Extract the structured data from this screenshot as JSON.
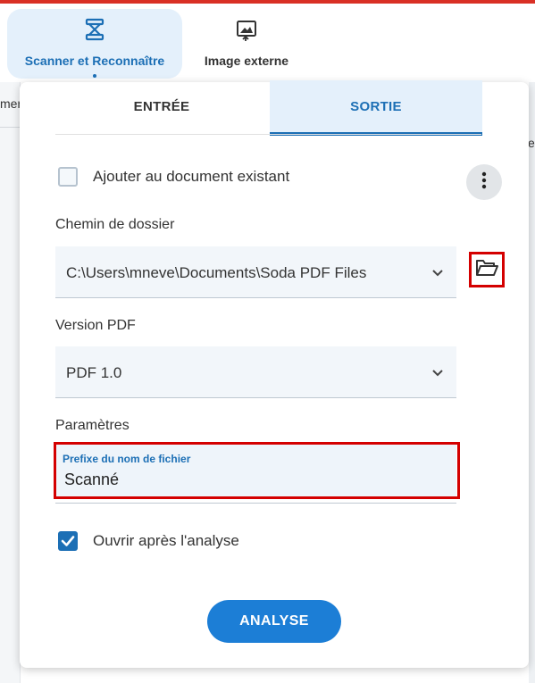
{
  "ribbon": {
    "tabs": [
      {
        "label": "Scanner et Reconnaître",
        "icon": "scanner-icon",
        "active": true
      },
      {
        "label": "Image externe",
        "icon": "image-import-icon",
        "active": false
      }
    ]
  },
  "background": {
    "left_fragment": "mer",
    "right_fragment": "er"
  },
  "panel": {
    "tabs": [
      {
        "label": "ENTRÉE",
        "active": false
      },
      {
        "label": "SORTIE",
        "active": true
      }
    ],
    "append_checkbox": {
      "label": "Ajouter au document existant",
      "checked": false
    },
    "folder_path": {
      "label": "Chemin de dossier",
      "value": "C:\\Users\\mneve\\Documents\\Soda PDF Files"
    },
    "pdf_version": {
      "label": "Version PDF",
      "value": "PDF 1.0"
    },
    "parameters": {
      "label": "Paramètres",
      "filename_prefix": {
        "label": "Prefixe du nom de fichier",
        "value": "Scanné"
      }
    },
    "open_after_checkbox": {
      "label": "Ouvrir après l'analyse",
      "checked": true
    },
    "scan_button": {
      "label": "ANALYSE"
    }
  },
  "colors": {
    "accent": "#1c6fb5",
    "primary_button": "#1c7ed6",
    "highlight": "#d40000",
    "top_bar": "#d93025"
  }
}
